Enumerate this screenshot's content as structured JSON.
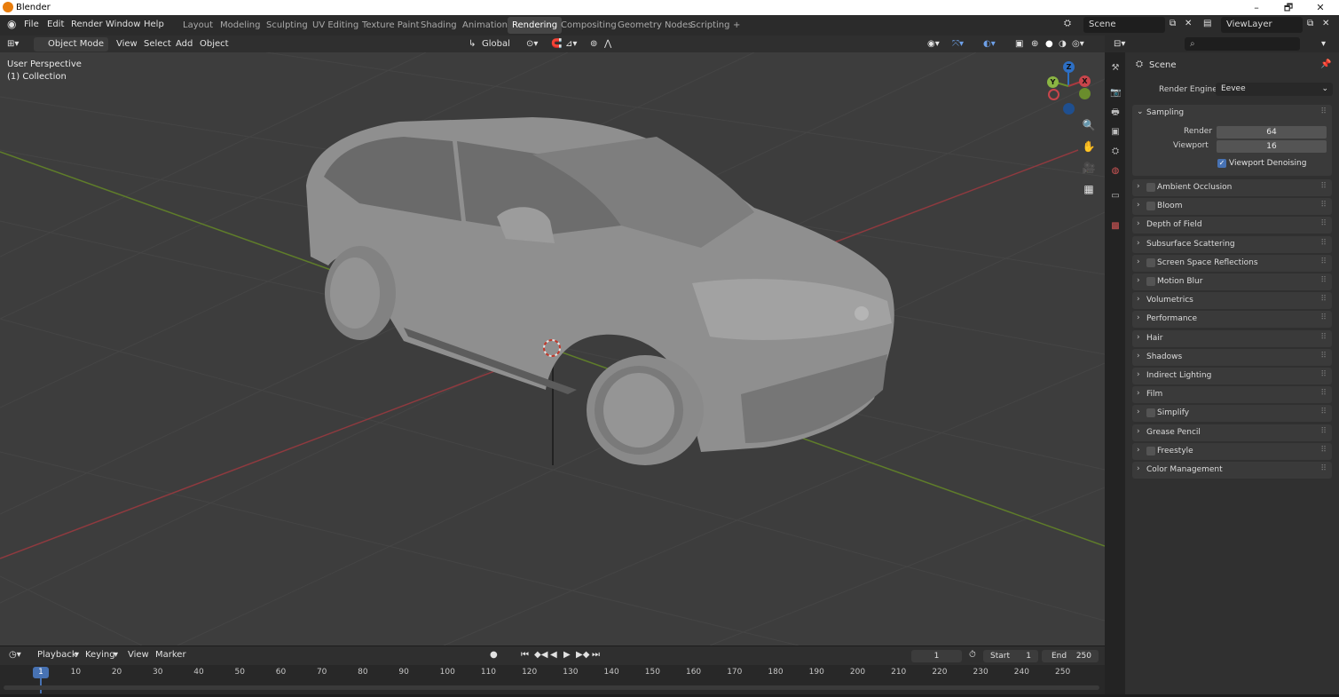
{
  "app": {
    "title": "Blender"
  },
  "window_controls": {
    "minimize": "–",
    "restore": "🗗",
    "close": "✕"
  },
  "menu": {
    "items": [
      "File",
      "Edit",
      "Render",
      "Window",
      "Help"
    ]
  },
  "workspaces": {
    "tabs": [
      "Layout",
      "Modeling",
      "Sculpting",
      "UV Editing",
      "Texture Paint",
      "Shading",
      "Animation",
      "Rendering",
      "Compositing",
      "Geometry Nodes",
      "Scripting"
    ],
    "active": "Rendering",
    "add": "+"
  },
  "scene_selector": {
    "value": "Scene"
  },
  "viewlayer_selector": {
    "value": "ViewLayer"
  },
  "viewport_header": {
    "mode": "Object Mode",
    "menus": [
      "View",
      "Select",
      "Add",
      "Object"
    ],
    "orientation": "Global"
  },
  "viewport": {
    "perspective_label": "User Perspective",
    "collection_label": "(1) Collection"
  },
  "gizmo": {
    "x": "X",
    "y": "Y",
    "z": "Z"
  },
  "timeline": {
    "menus": [
      "Playback",
      "Keying",
      "View",
      "Marker"
    ],
    "current_frame": "1",
    "start_label": "Start",
    "start_value": "1",
    "end_label": "End",
    "end_value": "250",
    "ticks": [
      "1",
      "10",
      "20",
      "30",
      "40",
      "50",
      "60",
      "70",
      "80",
      "90",
      "100",
      "110",
      "120",
      "130",
      "140",
      "150",
      "160",
      "170",
      "180",
      "190",
      "200",
      "210",
      "220",
      "230",
      "240",
      "250"
    ]
  },
  "properties": {
    "context": "Scene",
    "search_placeholder": "",
    "render_engine_label": "Render Engine",
    "render_engine_value": "Eevee",
    "sampling": {
      "label": "Sampling",
      "render_label": "Render",
      "render_value": "64",
      "viewport_label": "Viewport",
      "viewport_value": "16",
      "denoise_label": "Viewport Denoising",
      "denoise_checked": true
    },
    "panels": [
      {
        "label": "Ambient Occlusion",
        "checkbox": true
      },
      {
        "label": "Bloom",
        "checkbox": true
      },
      {
        "label": "Depth of Field",
        "checkbox": false
      },
      {
        "label": "Subsurface Scattering",
        "checkbox": false
      },
      {
        "label": "Screen Space Reflections",
        "checkbox": true
      },
      {
        "label": "Motion Blur",
        "checkbox": true
      },
      {
        "label": "Volumetrics",
        "checkbox": false
      },
      {
        "label": "Performance",
        "checkbox": false
      },
      {
        "label": "Hair",
        "checkbox": false
      },
      {
        "label": "Shadows",
        "checkbox": false
      },
      {
        "label": "Indirect Lighting",
        "checkbox": false
      },
      {
        "label": "Film",
        "checkbox": false
      },
      {
        "label": "Simplify",
        "checkbox": true
      },
      {
        "label": "Grease Pencil",
        "checkbox": false
      },
      {
        "label": "Freestyle",
        "checkbox": true
      },
      {
        "label": "Color Management",
        "checkbox": false
      }
    ]
  },
  "colors": {
    "accent": "#4772b3",
    "x_axis": "#a8393f",
    "y_axis": "#6a8d2c",
    "z_axis": "#2d6fc4",
    "active_frame": "#4772b3"
  }
}
